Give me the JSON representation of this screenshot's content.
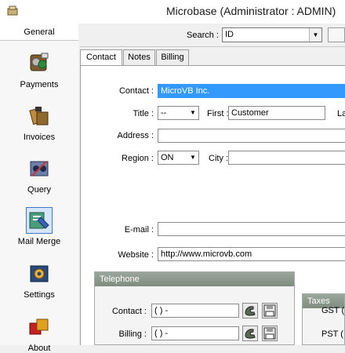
{
  "window": {
    "title": "Microbase (Administrator : ADMIN)"
  },
  "sidebar": {
    "header": "General",
    "items": [
      {
        "label": "Payments",
        "icon": "payments-icon"
      },
      {
        "label": "Invoices",
        "icon": "invoices-icon"
      },
      {
        "label": "Query",
        "icon": "query-icon"
      },
      {
        "label": "Mail Merge",
        "icon": "mail-merge-icon",
        "selected": true
      },
      {
        "label": "Settings",
        "icon": "settings-icon"
      },
      {
        "label": "About",
        "icon": "about-icon"
      }
    ]
  },
  "search": {
    "label": "Search :",
    "value": "ID"
  },
  "tabs": [
    "Contact",
    "Notes",
    "Billing"
  ],
  "form": {
    "contact_label": "Contact :",
    "contact_value": "MicroVB Inc.",
    "title_label": "Title :",
    "title_value": "--",
    "first_label": "First :",
    "first_value": "Customer",
    "last_label_partial": "La",
    "address_label": "Address :",
    "address_value": "",
    "region_label": "Region :",
    "region_value": "ON",
    "city_label": "City :",
    "city_value": "",
    "email_label": "E-mail :",
    "email_value": "",
    "website_label": "Website :",
    "website_value": "http://www.microvb.com"
  },
  "telephone": {
    "title": "Telephone",
    "contact_label": "Contact :",
    "contact_value": "(      )      -",
    "billing_label": "Billing :",
    "billing_value": "(      )      -"
  },
  "taxes": {
    "title": "Taxes",
    "gst_label": "GST (",
    "pst_label": "PST ("
  },
  "colors": {
    "selection": "#3399ff",
    "group_header": "#8a978a",
    "nav_selected_border": "#3c78c8"
  }
}
